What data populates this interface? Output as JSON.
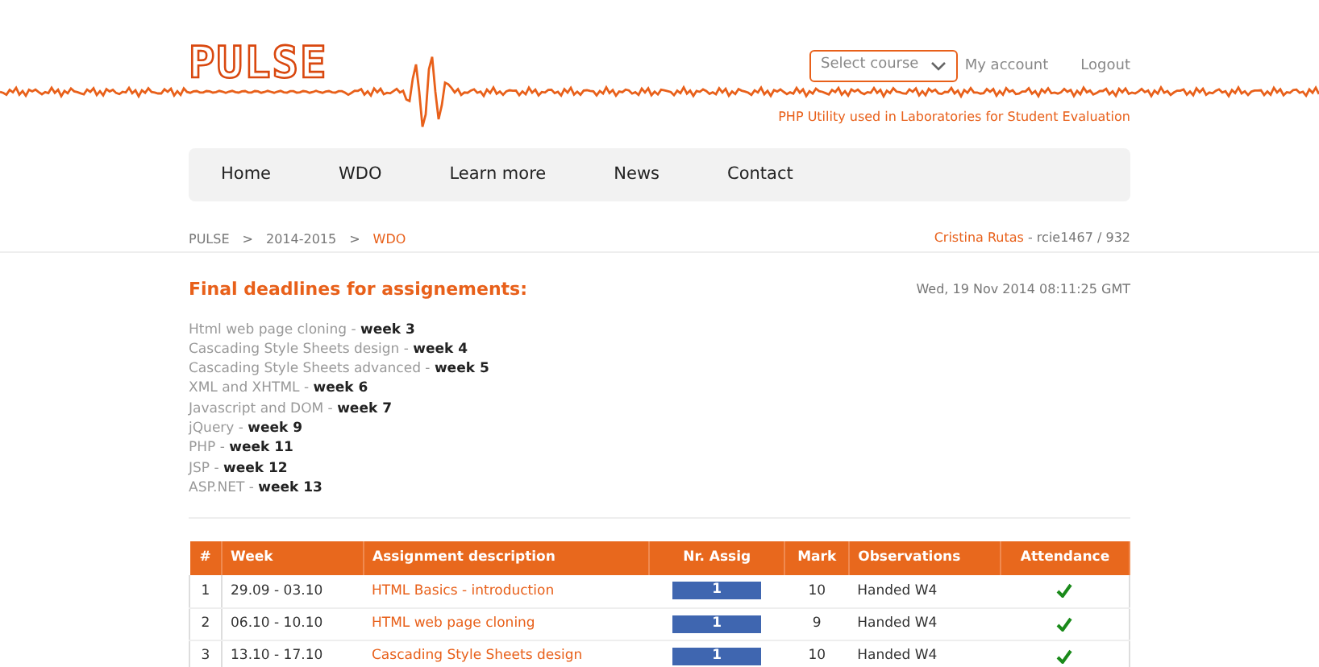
{
  "logo": "PULSE",
  "course_select": {
    "placeholder": "Select course"
  },
  "account_links": [
    "My account",
    "Logout"
  ],
  "tagline": "PHP Utility used in Laboratories for Student Evaluation",
  "nav": [
    {
      "label": "Home"
    },
    {
      "label": "WDO"
    },
    {
      "label": "Learn more"
    },
    {
      "label": "News"
    },
    {
      "label": "Contact"
    }
  ],
  "breadcrumb": [
    {
      "label": "PULSE",
      "current": false
    },
    {
      "label": "2014-2015",
      "current": false
    },
    {
      "label": "WDO",
      "current": true
    }
  ],
  "breadcrumb_separator": ">",
  "user": {
    "name": "Cristina Rutas",
    "id": "- rcie1467 / 932"
  },
  "heading": "Final deadlines for assignements:",
  "timestamp": "Wed, 19 Nov 2014 08:11:25 GMT",
  "deadlines": [
    {
      "topic": "Html web page cloning -",
      "week": "week 3"
    },
    {
      "topic": "Cascading Style Sheets design -",
      "week": "week 4"
    },
    {
      "topic": "Cascading Style Sheets advanced -",
      "week": "week 5"
    },
    {
      "topic": "XML and XHTML -",
      "week": "week 6"
    },
    {
      "topic": "Javascript and DOM -",
      "week": "week 7"
    },
    {
      "topic": "jQuery -",
      "week": "week 9"
    },
    {
      "topic": "PHP -",
      "week": "week 11"
    },
    {
      "topic": "JSP -",
      "week": "week 12"
    },
    {
      "topic": "ASP.NET -",
      "week": "week 13"
    }
  ],
  "table": {
    "columns": [
      "#",
      "Week",
      "Assignment description",
      "Nr. Assig",
      "Mark",
      "Observations",
      "Attendance"
    ],
    "rows": [
      {
        "num": "1",
        "week": "29.09 - 03.10",
        "description": "HTML Basics - introduction",
        "nr_assig": "1",
        "mark": "10",
        "observations": "Handed W4",
        "attended": true
      },
      {
        "num": "2",
        "week": "06.10 - 10.10",
        "description": "HTML web page cloning",
        "nr_assig": "1",
        "mark": "9",
        "observations": "Handed W4",
        "attended": true
      },
      {
        "num": "3",
        "week": "13.10 - 17.10",
        "description": "Cascading Style Sheets design",
        "nr_assig": "1",
        "mark": "10",
        "observations": "Handed W4",
        "attended": true
      }
    ]
  }
}
